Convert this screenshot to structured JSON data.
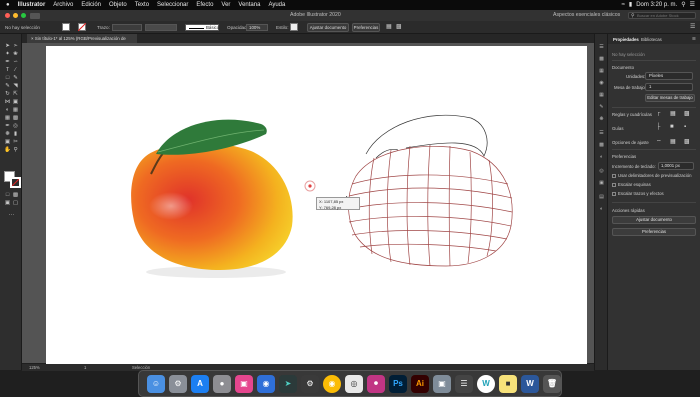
{
  "menubar": {
    "apple": "",
    "app_name": "Illustrator",
    "menus": [
      "Archivo",
      "Edición",
      "Objeto",
      "Texto",
      "Seleccionar",
      "Efecto",
      "Ver",
      "Ventana",
      "Ayuda"
    ],
    "clock": "Dom 3:20 p. m."
  },
  "appbar": {
    "title": "Adobe Illustrator 2020",
    "workspace": "Aspectos esenciales clásicos",
    "search_placeholder": "Buscar en Adobe Stock"
  },
  "control_bar": {
    "selection_label": "No hay selección",
    "stroke_label": "Trazo:",
    "stroke_style": "Básico",
    "opacity_label": "Opacidad:",
    "opacity_value": "100%",
    "style_label": "Estilo:",
    "doc_setup_btn": "Ajustar documento",
    "prefs_btn": "Preferencias"
  },
  "document_tab": {
    "label": "Sin título-1* al 125% (RGB/Previsualización de GPU)"
  },
  "canvas": {
    "tooltip_x": "X: 1107,85 px",
    "tooltip_y": "Y: 769,28 px"
  },
  "statusbar": {
    "zoom": "125%",
    "page": "1",
    "mode": "Selección"
  },
  "properties_panel": {
    "tab_properties": "Propiedades",
    "tab_libraries": "Bibliotecas",
    "no_selection": "No hay selección",
    "document_heading": "Documento",
    "units_label": "Unidades:",
    "units_value": "Píxeles",
    "artboard_label": "Mesa de trabajo:",
    "artboard_value": "1",
    "edit_artboards_btn": "Editar mesas de trabajo",
    "rulers_grids": "Reglas y cuadrículas",
    "guides": "Guías",
    "snap_options": "Opciones de ajuste",
    "preferences_heading": "Preferencias",
    "keyboard_increment_label": "Incremento de teclado:",
    "keyboard_increment_value": "1,0001 px",
    "opt_preview_bounds": "Usar delimitadores de previsualización",
    "opt_scale_corners": "Escalar esquinas",
    "opt_scale_strokes": "Escalar trazos y efectos",
    "quick_actions": "Acciones rápidas",
    "adjust_document_btn": "Ajustar documento",
    "preferences_btn": "Preferencias"
  },
  "dock": {
    "items": [
      "finder-icon",
      "launchpad-icon",
      "app-store-icon",
      "trash-icon"
    ]
  },
  "colors": {
    "mango_red": "#e0322a",
    "mango_yellow": "#f4c21f",
    "leaf_green": "#2f7a3a",
    "mesh_line": "#a04646"
  }
}
